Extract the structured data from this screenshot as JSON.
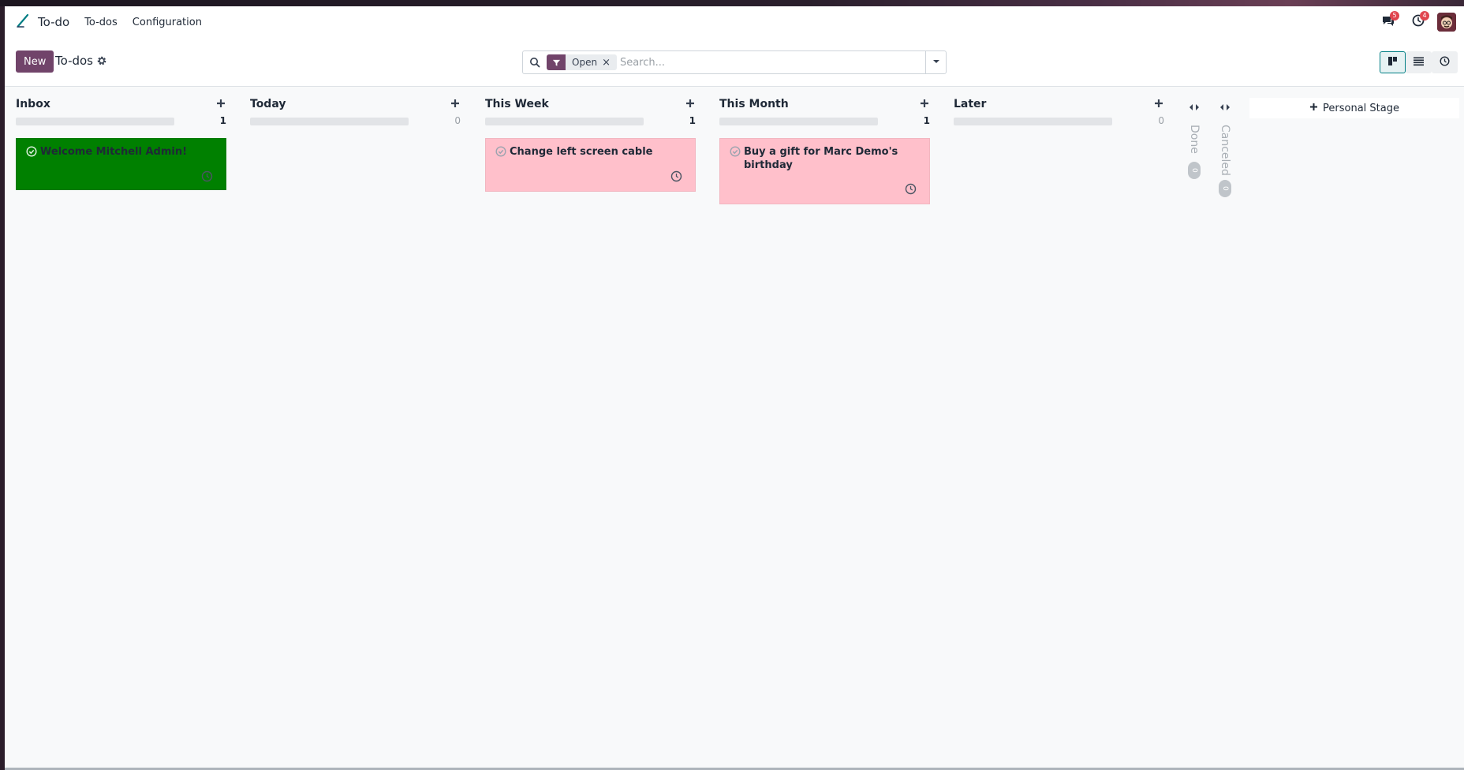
{
  "navbar": {
    "app_name": "To-do",
    "menu": [
      "To-dos",
      "Configuration"
    ],
    "messages_badge": "5",
    "activities_badge": "4"
  },
  "control_panel": {
    "new_label": "New",
    "title": "To-dos",
    "search": {
      "facet": "Open",
      "placeholder": "Search..."
    },
    "views": [
      "kanban",
      "list",
      "activity"
    ],
    "active_view": "kanban"
  },
  "kanban": {
    "columns": [
      {
        "title": "Inbox",
        "count": "1",
        "cards": [
          {
            "title": "Welcome Mitchell Admin!",
            "color": "#008000"
          }
        ]
      },
      {
        "title": "Today",
        "count": "0",
        "cards": []
      },
      {
        "title": "This Week",
        "count": "1",
        "cards": [
          {
            "title": "Change left screen cable",
            "color": "#ffc0cb"
          }
        ]
      },
      {
        "title": "This Month",
        "count": "1",
        "cards": [
          {
            "title": "Buy a gift for Marc Demo's birthday",
            "color": "#ffc0cb"
          }
        ]
      },
      {
        "title": "Later",
        "count": "0",
        "cards": []
      }
    ],
    "folded": [
      {
        "title": "Done",
        "count": "0"
      },
      {
        "title": "Canceled",
        "count": "0"
      }
    ],
    "add_stage_label": "Personal Stage"
  },
  "colors": {
    "brand": "#71446a",
    "accent": "#017e84",
    "badge": "#e0454f"
  }
}
